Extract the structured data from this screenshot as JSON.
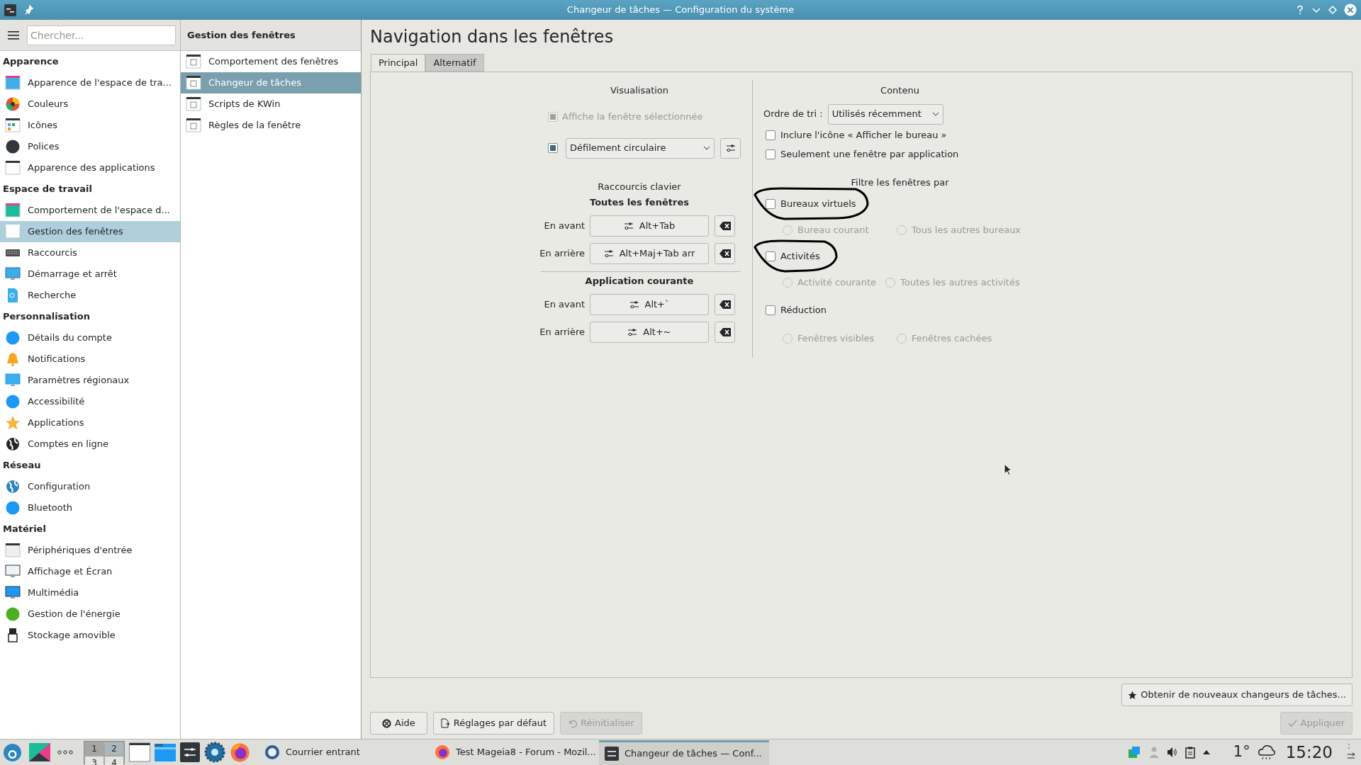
{
  "window": {
    "title": "Changeur de tâches — Configuration du système"
  },
  "sidebar": {
    "search": {
      "placeholder": "Chercher..."
    },
    "sections": [
      {
        "heading": "Apparence",
        "items": [
          {
            "label": "Apparence de l'espace de tra...",
            "selected": false
          },
          {
            "label": "Couleurs",
            "selected": false
          },
          {
            "label": "Icônes",
            "selected": false
          },
          {
            "label": "Polices",
            "selected": false
          },
          {
            "label": "Apparence des applications",
            "selected": false
          }
        ]
      },
      {
        "heading": "Espace de travail",
        "items": [
          {
            "label": "Comportement de l'espace d...",
            "selected": false
          },
          {
            "label": "Gestion des fenêtres",
            "selected": true
          },
          {
            "label": "Raccourcis",
            "selected": false
          },
          {
            "label": "Démarrage et arrêt",
            "selected": false
          },
          {
            "label": "Recherche",
            "selected": false
          }
        ]
      },
      {
        "heading": "Personnalisation",
        "items": [
          {
            "label": "Détails du compte",
            "selected": false
          },
          {
            "label": "Notifications",
            "selected": false
          },
          {
            "label": "Paramètres régionaux",
            "selected": false
          },
          {
            "label": "Accessibilité",
            "selected": false
          },
          {
            "label": "Applications",
            "selected": false
          },
          {
            "label": "Comptes en ligne",
            "selected": false
          }
        ]
      },
      {
        "heading": "Réseau",
        "items": [
          {
            "label": "Configuration",
            "selected": false
          },
          {
            "label": "Bluetooth",
            "selected": false
          }
        ]
      },
      {
        "heading": "Matériel",
        "items": [
          {
            "label": "Périphériques d'entrée",
            "selected": false
          },
          {
            "label": "Affichage et Écran",
            "selected": false
          },
          {
            "label": "Multimédia",
            "selected": false
          },
          {
            "label": "Gestion de l'énergie",
            "selected": false
          },
          {
            "label": "Stockage amovible",
            "selected": false
          }
        ]
      }
    ]
  },
  "subpanel": {
    "title": "Gestion des fenêtres",
    "items": [
      {
        "label": "Comportement des fenêtres",
        "selected": false
      },
      {
        "label": "Changeur de tâches",
        "selected": true
      },
      {
        "label": "Scripts de KWin",
        "selected": false
      },
      {
        "label": "Règles de la fenêtre",
        "selected": false
      }
    ]
  },
  "content": {
    "title": "Navigation dans les fenêtres",
    "tabs": [
      {
        "label": "Principal",
        "selected": true
      },
      {
        "label": "Alternatif",
        "selected": false
      }
    ],
    "visualisation": {
      "heading": "Visualisation",
      "show_selected": {
        "label": "Affiche la fenêtre sélectionnée",
        "checked": true,
        "disabled": true
      },
      "effect_enabled": {
        "checked": true
      },
      "effect": "Défilement circulaire"
    },
    "shortcuts": {
      "heading": "Raccourcis clavier",
      "groups": [
        {
          "heading": "Toutes les fenêtres",
          "rows": [
            {
              "label": "En avant",
              "shortcut": "Alt+Tab"
            },
            {
              "label": "En arrière",
              "shortcut": "Alt+Maj+Tab arr"
            }
          ]
        },
        {
          "heading": "Application courante",
          "rows": [
            {
              "label": "En avant",
              "shortcut": "Alt+`"
            },
            {
              "label": "En arrière",
              "shortcut": "Alt+~"
            }
          ]
        }
      ]
    },
    "contenu": {
      "heading": "Contenu",
      "sort_label": "Ordre de tri :",
      "sort_value": "Utilisés récemment",
      "checkboxes": [
        {
          "label": "Inclure l'icône « Afficher le bureau »",
          "checked": false
        },
        {
          "label": "Seulement une fenêtre par application",
          "checked": false
        }
      ],
      "filter_heading": "Filtre les fenêtres par",
      "filters": [
        {
          "label": "Bureaux virtuels",
          "checked": false,
          "circled": true,
          "options": [
            {
              "label": "Bureau courant",
              "selected": false,
              "disabled": true
            },
            {
              "label": "Tous les autres bureaux",
              "selected": false,
              "disabled": true
            }
          ]
        },
        {
          "label": "Activités",
          "checked": false,
          "circled": true,
          "options": [
            {
              "label": "Activité courante",
              "selected": false,
              "disabled": true
            },
            {
              "label": "Toutes les autres activités",
              "selected": false,
              "disabled": true
            }
          ]
        },
        {
          "label": "Réduction",
          "checked": false,
          "circled": false,
          "options": [
            {
              "label": "Fenêtres visibles",
              "selected": false,
              "disabled": true
            },
            {
              "label": "Fenêtres cachées",
              "selected": false,
              "disabled": true
            }
          ]
        }
      ]
    }
  },
  "buttons": {
    "get_new": {
      "label": "Obtenir de nouveaux changeurs de tâches...",
      "disabled": false
    },
    "help": {
      "label": "Aide",
      "disabled": false
    },
    "defaults": {
      "label": "Réglages par défaut",
      "disabled": false
    },
    "reset": {
      "label": "Réinitialiser",
      "disabled": true
    },
    "apply": {
      "label": "Appliquer",
      "disabled": true
    }
  },
  "taskbar": {
    "pager": [
      {
        "label": "1",
        "selected": true
      },
      {
        "label": "2",
        "selected": false
      },
      {
        "label": "3",
        "selected": false
      },
      {
        "label": "4",
        "selected": false
      }
    ],
    "tasks": [
      {
        "label": "Courrier entrant",
        "active": false
      },
      {
        "label": "Test Mageia8 - Forum - Mozil...",
        "active": false
      },
      {
        "label": "Changeur de tâches  — Conf...",
        "active": true
      }
    ],
    "temperature": "1°",
    "clock": "15:20"
  }
}
